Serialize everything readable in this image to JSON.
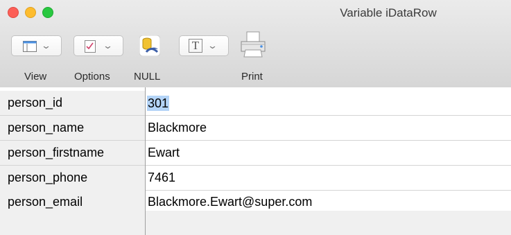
{
  "window": {
    "title": "Variable iDataRow"
  },
  "toolbar": {
    "view_label": "View",
    "options_label": "Options",
    "null_label": "NULL",
    "print_label": "Print",
    "text_button_glyph": "T"
  },
  "rows": [
    {
      "field": "person_id",
      "value": "301",
      "selected": true
    },
    {
      "field": "person_name",
      "value": "Blackmore"
    },
    {
      "field": "person_firstname",
      "value": "Ewart"
    },
    {
      "field": "person_phone",
      "value": "7461"
    },
    {
      "field": "person_email",
      "value": "Blackmore.Ewart@super.com"
    }
  ],
  "colors": {
    "selection": "#b4d4f7",
    "close": "#fc5f57",
    "minimize": "#fdbc2e",
    "zoom": "#29c840"
  }
}
